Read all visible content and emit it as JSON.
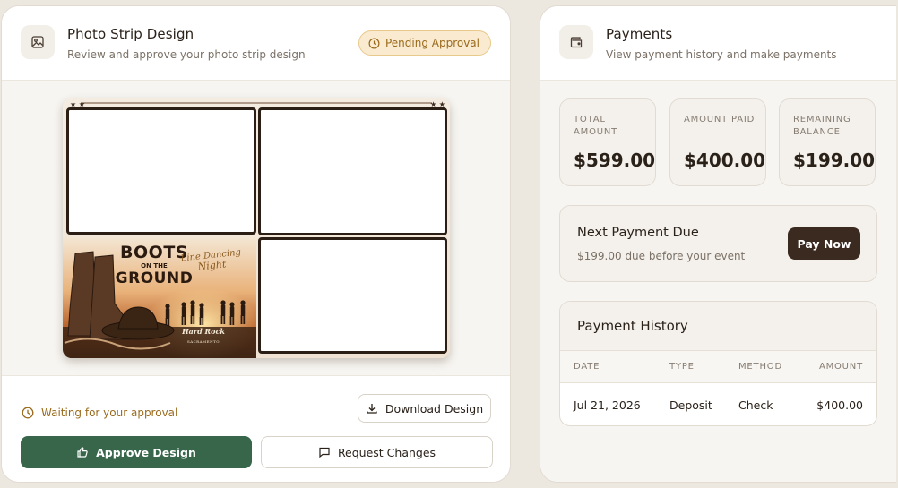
{
  "photo_card": {
    "title": "Photo Strip Design",
    "subtitle": "Review and approve your photo strip design",
    "status_badge": "Pending Approval",
    "artwork": {
      "headline_top": "BOOTS",
      "headline_mid": "ON THE",
      "headline_bottom": "GROUND",
      "script_line1": "Line Dancing",
      "script_line2": "Night",
      "logo_text": "Hard Rock",
      "logo_sub": "SACRAMENTO"
    },
    "waiting_text": "Waiting for your approval",
    "download_label": "Download Design",
    "approve_label": "Approve Design",
    "request_label": "Request Changes"
  },
  "payments_card": {
    "title": "Payments",
    "subtitle": "View payment history and make payments",
    "stats": [
      {
        "label": "TOTAL\nAMOUNT",
        "value": "$599.00"
      },
      {
        "label": "AMOUNT PAID",
        "value": "$400.00"
      },
      {
        "label": "REMAINING\nBALANCE",
        "value": "$199.00"
      }
    ],
    "next_payment": {
      "title": "Next Payment Due",
      "subtitle": "$199.00 due before your event",
      "button_label": "Pay Now"
    },
    "history": {
      "title": "Payment History",
      "columns": [
        "DATE",
        "TYPE",
        "METHOD",
        "AMOUNT"
      ],
      "rows": [
        {
          "date": "Jul 21, 2026",
          "type": "Deposit",
          "method": "Check",
          "amount": "$400.00"
        }
      ]
    }
  },
  "colors": {
    "approve_green": "#37664a",
    "pending_amber": "#9a6a1c",
    "pay_now_dark": "#3a2a20",
    "page_background": "#ece7df"
  },
  "icons": {
    "photo_header": "image-icon",
    "payments_header": "wallet-icon",
    "pending": "clock-icon",
    "download": "download-icon",
    "approve": "thumbs-up-icon",
    "request": "message-square-icon"
  }
}
